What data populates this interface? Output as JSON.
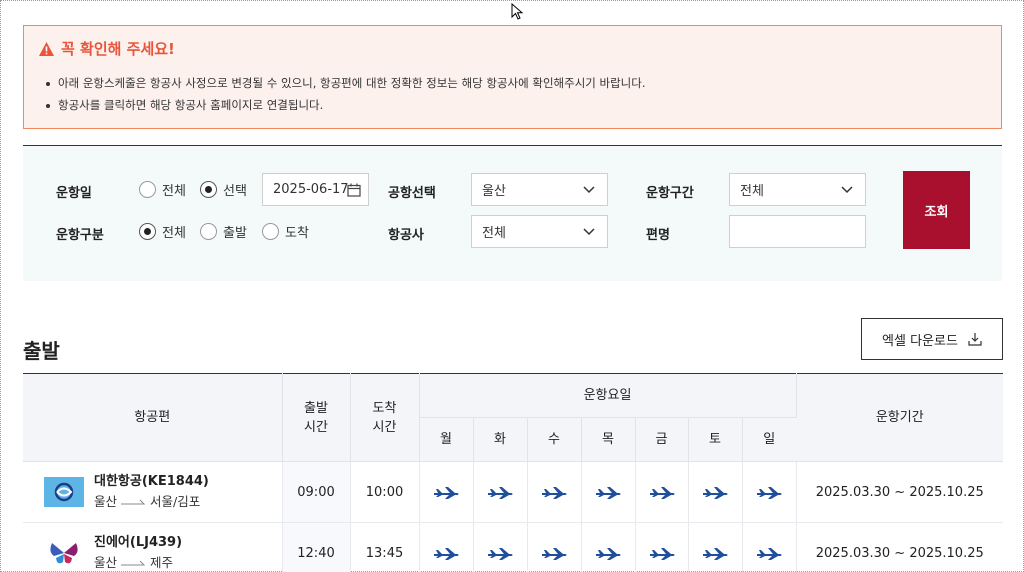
{
  "notice": {
    "title": "꼭 확인해 주세요!",
    "items": [
      "아래 운항스케줄은 항공사 사정으로 변경될 수 있으니, 항공편에 대한 정확한 정보는 해당 항공사에 확인해주시기 바랍니다.",
      "항공사를 클릭하면 해당 항공사 홈페이지로 연결됩니다."
    ]
  },
  "search": {
    "date_label": "운항일",
    "date_all": "전체",
    "date_select": "선택",
    "date_value": "2025-06-17",
    "airport_label": "공항선택",
    "airport_value": "울산",
    "section_label": "운항구간",
    "section_value": "전체",
    "type_label": "운항구분",
    "type_all": "전체",
    "type_dep": "출발",
    "type_arr": "도착",
    "airline_label": "항공사",
    "airline_value": "전체",
    "flight_label": "편명",
    "flight_value": "",
    "search_button": "조회"
  },
  "section": {
    "title": "출발",
    "excel_button": "엑셀 다운로드"
  },
  "table": {
    "headers": {
      "flight": "항공편",
      "dep_time_1": "출발",
      "dep_time_2": "시간",
      "arr_time_1": "도착",
      "arr_time_2": "시간",
      "days": "운항요일",
      "period": "운항기간"
    },
    "days": [
      "월",
      "화",
      "수",
      "목",
      "금",
      "토",
      "일"
    ],
    "rows": [
      {
        "airline": "대한항공(KE1844)",
        "origin": "울산",
        "destination": "서울/김포",
        "dep": "09:00",
        "arr": "10:00",
        "period": "2025.03.30 ~ 2025.10.25",
        "logo": "korean-air-logo"
      },
      {
        "airline": "진에어(LJ439)",
        "origin": "울산",
        "destination": "제주",
        "dep": "12:40",
        "arr": "13:45",
        "period": "2025.03.30 ~ 2025.10.25",
        "logo": "jinair-logo"
      }
    ]
  },
  "colors": {
    "accent": "#a8102e",
    "notice_title": "#e8553a",
    "notice_border": "#f0895e",
    "plane": "#1f4e9c"
  }
}
